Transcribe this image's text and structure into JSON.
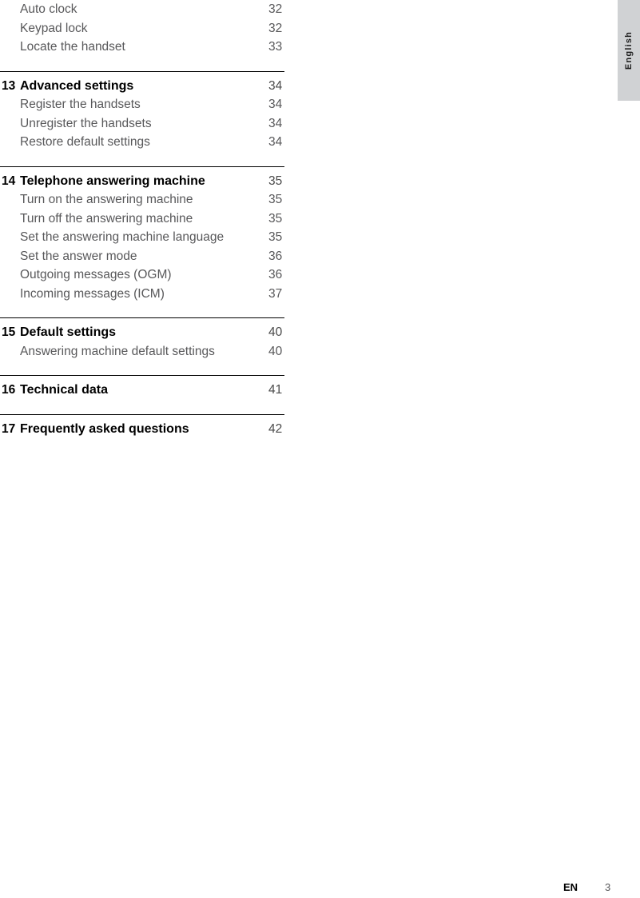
{
  "language_tab": {
    "label": "English"
  },
  "footer": {
    "language_code": "EN",
    "page_number": "3"
  },
  "toc": {
    "groups": [
      {
        "has_rule": false,
        "rows": [
          {
            "type": "entry",
            "number": "",
            "title": "Auto clock",
            "page": "32"
          },
          {
            "type": "entry",
            "number": "",
            "title": "Keypad lock",
            "page": "32"
          },
          {
            "type": "entry",
            "number": "",
            "title": "Locate the handset",
            "page": "33"
          }
        ]
      },
      {
        "has_rule": true,
        "rows": [
          {
            "type": "heading",
            "number": "13",
            "title": "Advanced settings",
            "page": "34"
          },
          {
            "type": "entry",
            "number": "",
            "title": "Register the handsets",
            "page": "34"
          },
          {
            "type": "entry",
            "number": "",
            "title": "Unregister the handsets",
            "page": "34"
          },
          {
            "type": "entry",
            "number": "",
            "title": "Restore default settings",
            "page": "34"
          }
        ]
      },
      {
        "has_rule": true,
        "rows": [
          {
            "type": "heading",
            "number": "14",
            "title": "Telephone answering machine",
            "page": "35"
          },
          {
            "type": "entry",
            "number": "",
            "title": "Turn on the answering machine",
            "page": "35"
          },
          {
            "type": "entry",
            "number": "",
            "title": "Turn off the answering machine",
            "page": "35"
          },
          {
            "type": "entry",
            "number": "",
            "title": "Set the answering machine language",
            "page": "35"
          },
          {
            "type": "entry",
            "number": "",
            "title": "Set the answer mode",
            "page": "36"
          },
          {
            "type": "entry",
            "number": "",
            "title": "Outgoing messages (OGM)",
            "page": "36"
          },
          {
            "type": "entry",
            "number": "",
            "title": "Incoming messages (ICM)",
            "page": "37"
          }
        ]
      },
      {
        "has_rule": true,
        "rows": [
          {
            "type": "heading",
            "number": "15",
            "title": "Default settings",
            "page": "40"
          },
          {
            "type": "entry",
            "number": "",
            "title": "Answering machine default settings",
            "page": "40"
          }
        ]
      },
      {
        "has_rule": true,
        "rows": [
          {
            "type": "heading",
            "number": "16",
            "title": "Technical data",
            "page": "41"
          }
        ]
      },
      {
        "has_rule": true,
        "rows": [
          {
            "type": "heading",
            "number": "17",
            "title": "Frequently asked questions",
            "page": "42"
          }
        ]
      }
    ]
  }
}
